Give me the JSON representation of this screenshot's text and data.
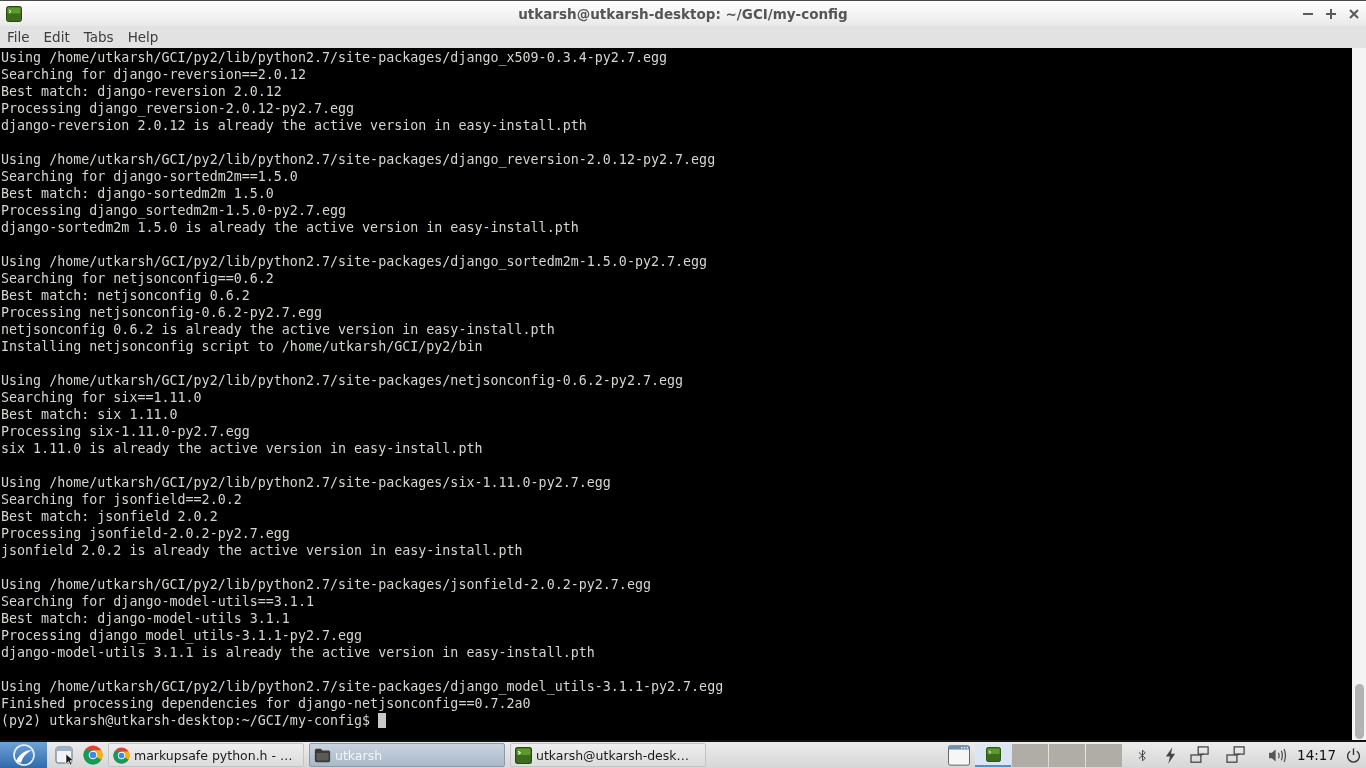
{
  "window": {
    "title": "utkarsh@utkarsh-desktop: ~/GCI/my-config"
  },
  "menu": [
    "File",
    "Edit",
    "Tabs",
    "Help"
  ],
  "terminal": {
    "blocks": [
      [
        "Using /home/utkarsh/GCI/py2/lib/python2.7/site-packages/django_x509-0.3.4-py2.7.egg",
        "Searching for django-reversion==2.0.12",
        "Best match: django-reversion 2.0.12",
        "Processing django_reversion-2.0.12-py2.7.egg",
        "django-reversion 2.0.12 is already the active version in easy-install.pth"
      ],
      [
        "Using /home/utkarsh/GCI/py2/lib/python2.7/site-packages/django_reversion-2.0.12-py2.7.egg",
        "Searching for django-sortedm2m==1.5.0",
        "Best match: django-sortedm2m 1.5.0",
        "Processing django_sortedm2m-1.5.0-py2.7.egg",
        "django-sortedm2m 1.5.0 is already the active version in easy-install.pth"
      ],
      [
        "Using /home/utkarsh/GCI/py2/lib/python2.7/site-packages/django_sortedm2m-1.5.0-py2.7.egg",
        "Searching for netjsonconfig==0.6.2",
        "Best match: netjsonconfig 0.6.2",
        "Processing netjsonconfig-0.6.2-py2.7.egg",
        "netjsonconfig 0.6.2 is already the active version in easy-install.pth",
        "Installing netjsonconfig script to /home/utkarsh/GCI/py2/bin"
      ],
      [
        "Using /home/utkarsh/GCI/py2/lib/python2.7/site-packages/netjsonconfig-0.6.2-py2.7.egg",
        "Searching for six==1.11.0",
        "Best match: six 1.11.0",
        "Processing six-1.11.0-py2.7.egg",
        "six 1.11.0 is already the active version in easy-install.pth"
      ],
      [
        "Using /home/utkarsh/GCI/py2/lib/python2.7/site-packages/six-1.11.0-py2.7.egg",
        "Searching for jsonfield==2.0.2",
        "Best match: jsonfield 2.0.2",
        "Processing jsonfield-2.0.2-py2.7.egg",
        "jsonfield 2.0.2 is already the active version in easy-install.pth"
      ],
      [
        "Using /home/utkarsh/GCI/py2/lib/python2.7/site-packages/jsonfield-2.0.2-py2.7.egg",
        "Searching for django-model-utils==3.1.1",
        "Best match: django-model-utils 3.1.1",
        "Processing django_model_utils-3.1.1-py2.7.egg",
        "django-model-utils 3.1.1 is already the active version in easy-install.pth"
      ],
      [
        "Using /home/utkarsh/GCI/py2/lib/python2.7/site-packages/django_model_utils-3.1.1-py2.7.egg",
        "Finished processing dependencies for django-netjsonconfig==0.7.2a0"
      ]
    ],
    "prompt": "(py2) utkarsh@utkarsh-desktop:~/GCI/my-config$"
  },
  "taskbar": {
    "tasks": [
      {
        "label": "markupsafe python.h - …",
        "kind": "browser",
        "selected": false
      },
      {
        "label": "utkarsh",
        "kind": "folder",
        "selected": true
      },
      {
        "label": "utkarsh@utkarsh-desk…",
        "kind": "terminal",
        "selected": false
      }
    ],
    "desktops": [
      {
        "selected": true
      },
      {
        "selected": false
      },
      {
        "selected": false
      },
      {
        "selected": false
      }
    ],
    "clock": "14:17"
  }
}
